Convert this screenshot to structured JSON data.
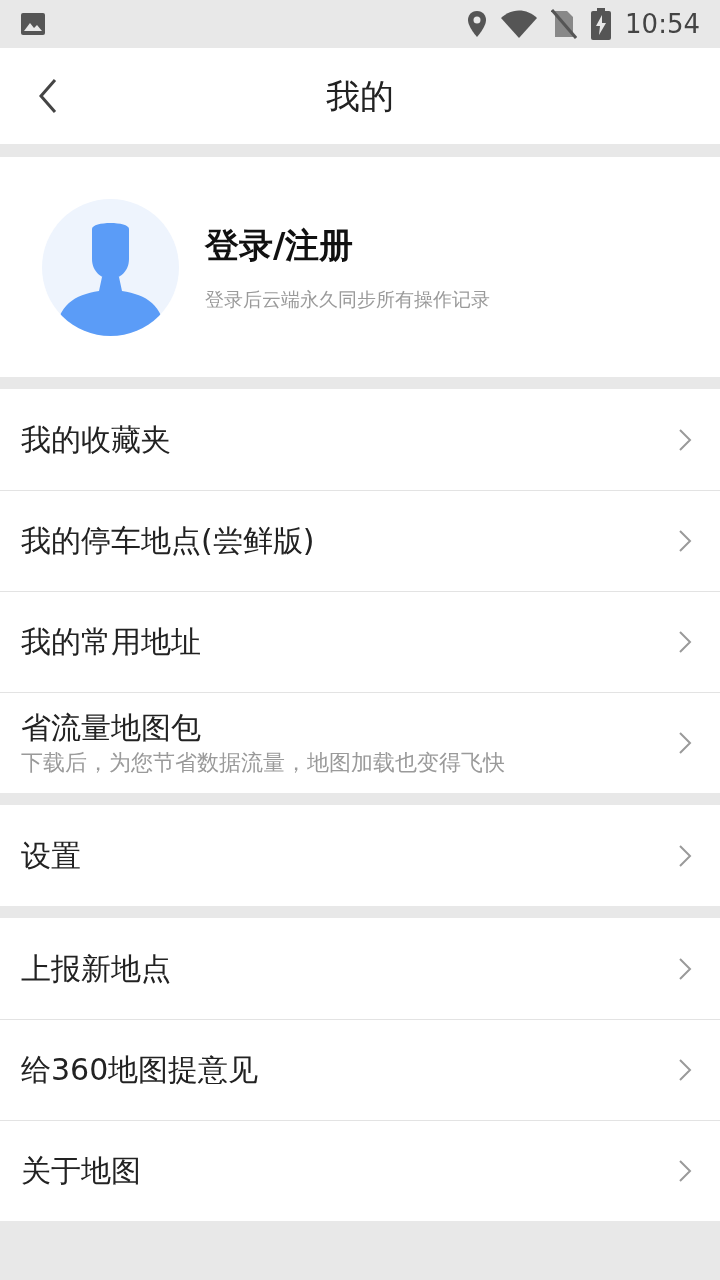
{
  "status_bar": {
    "time": "10:54"
  },
  "header": {
    "title": "我的"
  },
  "profile": {
    "title": "登录/注册",
    "subtitle": "登录后云端永久同步所有操作记录"
  },
  "groups": [
    {
      "rows": [
        {
          "label": "我的收藏夹"
        },
        {
          "label": "我的停车地点(尝鲜版)"
        },
        {
          "label": "我的常用地址"
        },
        {
          "label": "省流量地图包",
          "subtitle": "下载后，为您节省数据流量，地图加载也变得飞快"
        }
      ]
    },
    {
      "rows": [
        {
          "label": "设置"
        }
      ]
    },
    {
      "rows": [
        {
          "label": "上报新地点"
        },
        {
          "label": "给360地图提意见"
        },
        {
          "label": "关于地图"
        }
      ]
    }
  ]
}
